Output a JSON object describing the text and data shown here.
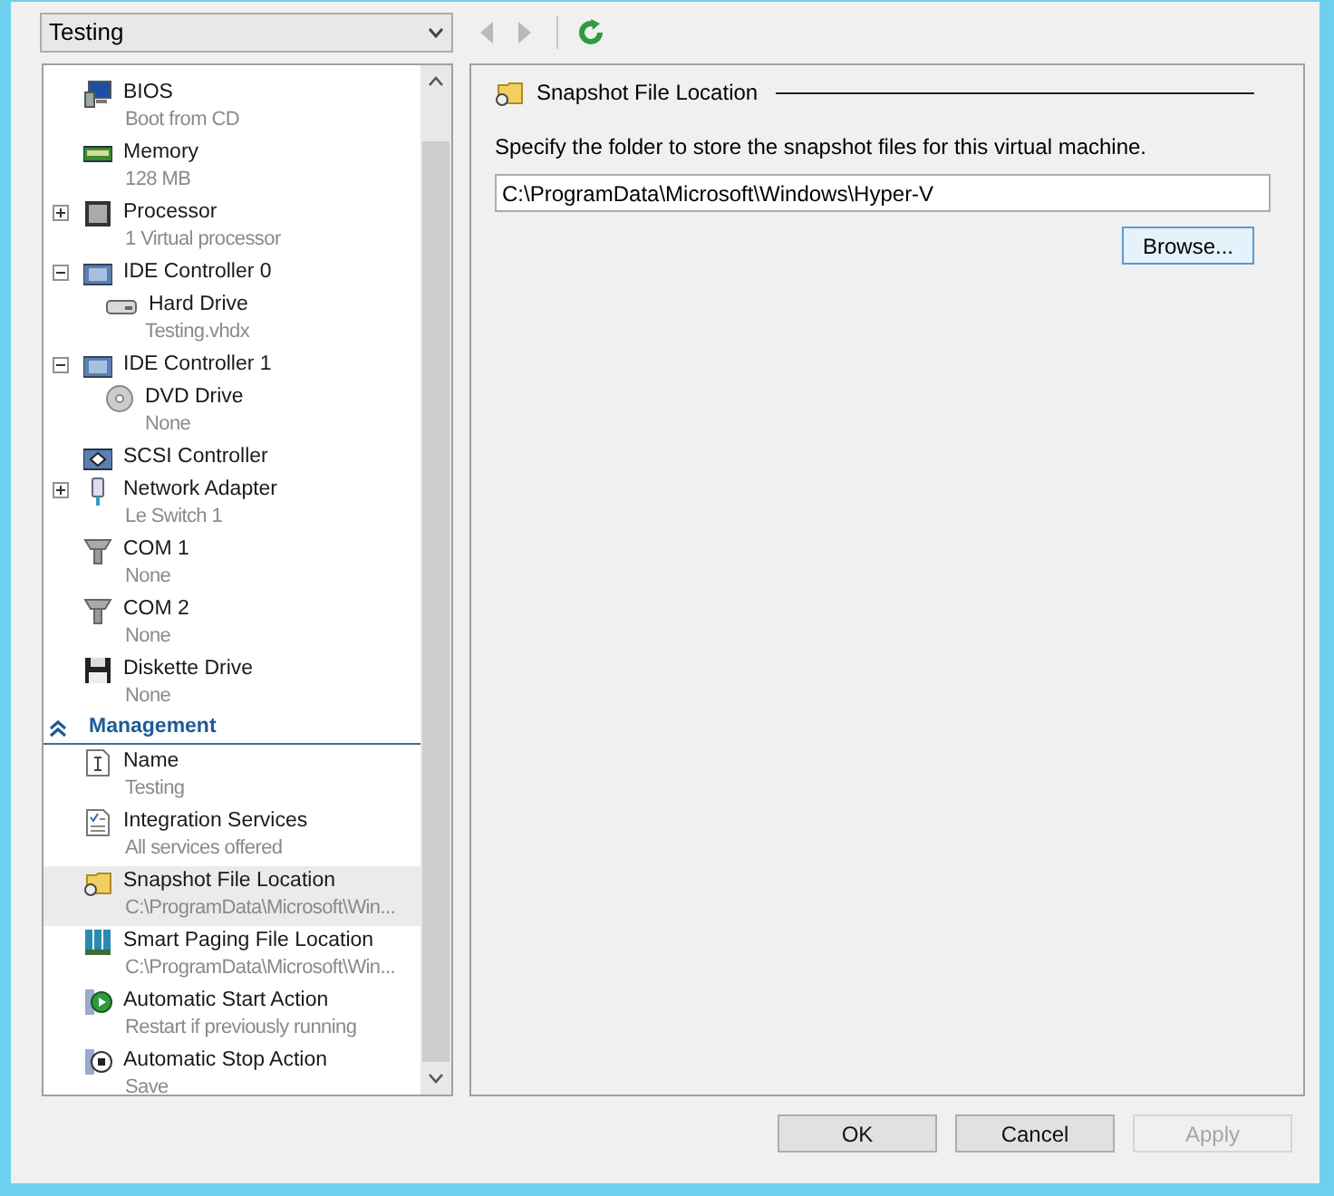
{
  "vm_selector": {
    "value": "Testing"
  },
  "toolbar": [
    {
      "kind": "back",
      "disabled": true
    },
    {
      "kind": "forward",
      "disabled": true
    },
    {
      "kind": "refresh",
      "disabled": false
    }
  ],
  "hardware_items": [
    {
      "kind": "bios",
      "title": "BIOS",
      "detail": "Boot from CD",
      "selected": false
    },
    {
      "kind": "memory",
      "title": "Memory",
      "detail": "128 MB",
      "selected": false
    },
    {
      "kind": "processor",
      "title": "Processor",
      "detail": "1 Virtual processor",
      "selected": false,
      "expanded": false
    },
    {
      "kind": "controller",
      "title": "IDE Controller 0",
      "selected": false,
      "expanded": true,
      "children": [
        {
          "kind": "harddrive",
          "title": "Hard Drive",
          "detail": "Testing.vhdx",
          "selected": false
        }
      ]
    },
    {
      "kind": "controller",
      "title": "IDE Controller 1",
      "selected": false,
      "expanded": true,
      "children": [
        {
          "kind": "dvd",
          "title": "DVD Drive",
          "detail": "None",
          "selected": false
        }
      ]
    },
    {
      "kind": "scsi",
      "title": "SCSI Controller",
      "selected": false
    },
    {
      "kind": "network",
      "title": "Network Adapter",
      "detail": "Le Switch 1",
      "selected": false,
      "expanded": false
    },
    {
      "kind": "com",
      "title": "COM 1",
      "detail": "None",
      "selected": false
    },
    {
      "kind": "com",
      "title": "COM 2",
      "detail": "None",
      "selected": false
    },
    {
      "kind": "diskette",
      "title": "Diskette Drive",
      "detail": "None",
      "selected": false
    }
  ],
  "management": {
    "title": "Management",
    "expanded": true,
    "items": [
      {
        "kind": "name",
        "title": "Name",
        "detail": "Testing",
        "selected": false
      },
      {
        "kind": "integration",
        "title": "Integration Services",
        "detail": "All services offered",
        "selected": false
      },
      {
        "kind": "snapshot",
        "title": "Snapshot File Location",
        "detail": "C:\\ProgramData\\Microsoft\\Win...",
        "selected": true
      },
      {
        "kind": "paging",
        "title": "Smart Paging File Location",
        "detail": "C:\\ProgramData\\Microsoft\\Win...",
        "selected": false
      },
      {
        "kind": "start",
        "title": "Automatic Start Action",
        "detail": "Restart if previously running",
        "selected": false
      },
      {
        "kind": "stop",
        "title": "Automatic Stop Action",
        "detail": "Save",
        "selected": false
      }
    ]
  },
  "details": {
    "title": "Snapshot File Location",
    "description": "Specify the folder to store the snapshot files for this virtual machine.",
    "path_field": {
      "value": "C:\\ProgramData\\Microsoft\\Windows\\Hyper-V"
    },
    "browse_button": "Browse..."
  },
  "footer_buttons": [
    {
      "label": "OK",
      "disabled": false
    },
    {
      "label": "Cancel",
      "disabled": false
    },
    {
      "label": "Apply",
      "disabled": true
    }
  ]
}
